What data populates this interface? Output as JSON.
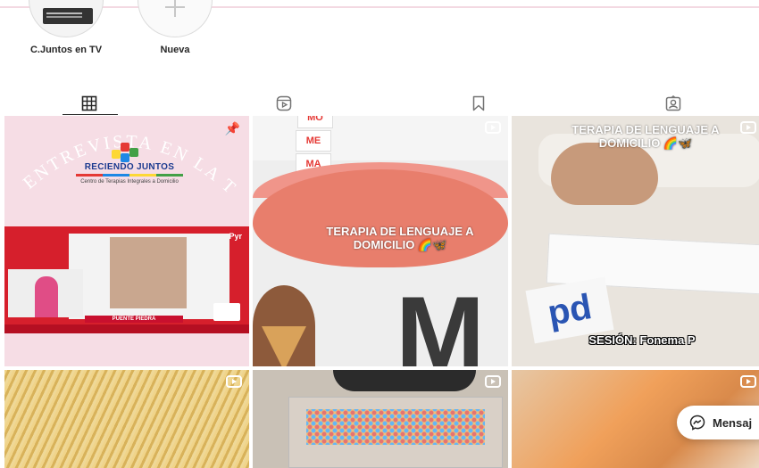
{
  "highlights": [
    {
      "label": "C.Juntos en TV"
    },
    {
      "label": "Nueva"
    }
  ],
  "tabs": [
    "grid-icon",
    "reels-icon",
    "saved-icon",
    "tagged-icon"
  ],
  "posts": {
    "p1": {
      "logo_title": "RECIENDO JUNTOS",
      "logo_sub": "Centro de Terapias Integrales a Domicilio",
      "arc": "ENTREVISTA EN LA TV",
      "tv_bar": "PUENTE PIEDRA",
      "tv_brand": "Pyr"
    },
    "p2": {
      "overlay": "TERAPIA DE LENGUAJE A DOMICILIO 🌈🦋",
      "cards": [
        "MO",
        "ME",
        "MA"
      ],
      "letter": "M"
    },
    "p3": {
      "overlay_top": "TERAPIA DE LENGUAJE A DOMICILIO 🌈🦋",
      "overlay_bottom": "SESIÓN: Fonema P",
      "card_text": "pd"
    }
  },
  "message_button": {
    "label": "Mensaj"
  },
  "colors": {
    "accent_pink": "#f3d9e2",
    "text": "#262626",
    "tv_red": "#d61f2c"
  }
}
